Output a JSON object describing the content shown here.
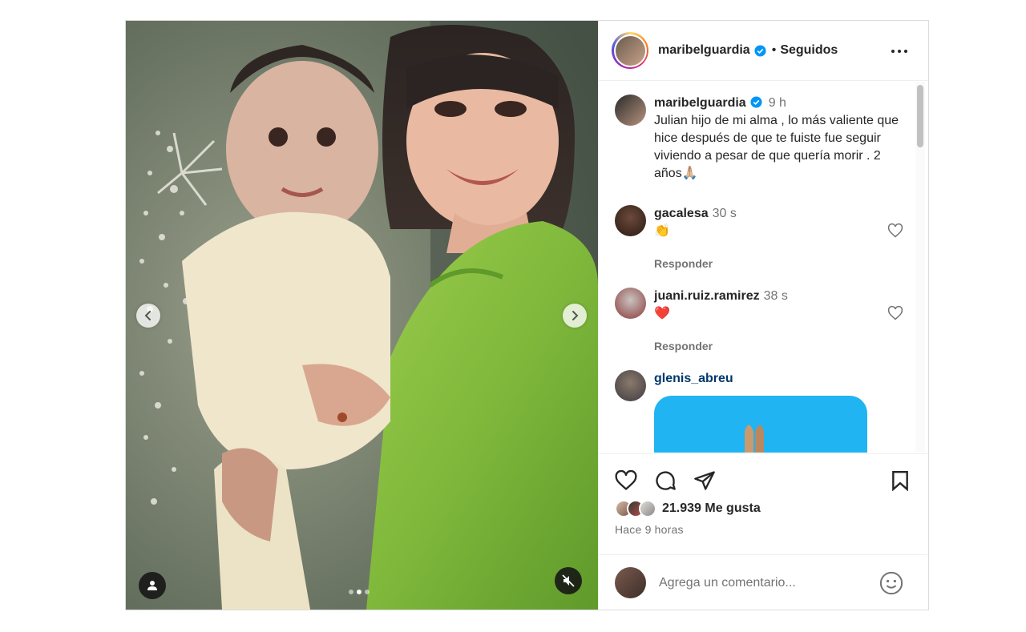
{
  "post": {
    "author": "maribelguardia",
    "follow_state": "Seguidos",
    "header_separator": "•"
  },
  "caption": {
    "author": "maribelguardia",
    "time": "9 h",
    "text": "Julian hijo de mi alma , lo más valiente que hice después de que te fuiste fue seguir viviendo a pesar de que quería morir . 2 años🙏🏼"
  },
  "comments": [
    {
      "user": "gacalesa",
      "time": "30 s",
      "text": "👏",
      "reply_label": "Responder"
    },
    {
      "user": "juani.ruiz.ramirez",
      "time": "38 s",
      "text": "❤️",
      "reply_label": "Responder"
    },
    {
      "user": "glenis_abreu",
      "time": "",
      "text": "🙏",
      "reply_label": ""
    }
  ],
  "likes": {
    "count_label": "21.939 Me gusta",
    "time_ago": "Hace 9 horas"
  },
  "composer": {
    "placeholder": "Agrega un comentario..."
  },
  "carousel": {
    "slide_count": 3,
    "active_index": 1
  },
  "colors": {
    "verified_blue": "#0095f6",
    "muted_text": "#737373",
    "dress_green": "#7fb83b"
  }
}
